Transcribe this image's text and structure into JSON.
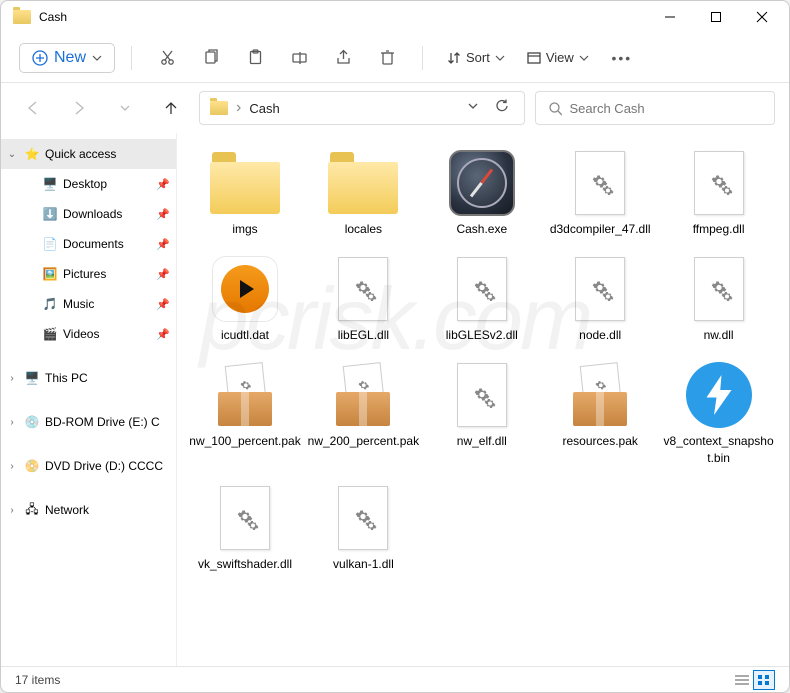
{
  "window": {
    "title": "Cash"
  },
  "toolbar": {
    "new_label": "New",
    "sort_label": "Sort",
    "view_label": "View"
  },
  "address": {
    "path_sep": "›",
    "path_name": "Cash",
    "search_placeholder": "Search Cash"
  },
  "sidebar": {
    "quick_access": "Quick access",
    "quick_items": [
      {
        "label": "Desktop",
        "icon": "desktop"
      },
      {
        "label": "Downloads",
        "icon": "downloads"
      },
      {
        "label": "Documents",
        "icon": "documents"
      },
      {
        "label": "Pictures",
        "icon": "pictures"
      },
      {
        "label": "Music",
        "icon": "music"
      },
      {
        "label": "Videos",
        "icon": "videos"
      }
    ],
    "this_pc": "This PC",
    "bd_drive": "BD-ROM Drive (E:) C",
    "dvd_drive": "DVD Drive (D:) CCCC",
    "network": "Network"
  },
  "files": [
    {
      "name": "imgs",
      "kind": "folder"
    },
    {
      "name": "locales",
      "kind": "folder"
    },
    {
      "name": "Cash.exe",
      "kind": "compass"
    },
    {
      "name": "d3dcompiler_47.dll",
      "kind": "dll"
    },
    {
      "name": "ffmpeg.dll",
      "kind": "dll"
    },
    {
      "name": "icudtl.dat",
      "kind": "play"
    },
    {
      "name": "libEGL.dll",
      "kind": "dll"
    },
    {
      "name": "libGLESv2.dll",
      "kind": "dll"
    },
    {
      "name": "node.dll",
      "kind": "dll"
    },
    {
      "name": "nw.dll",
      "kind": "dll"
    },
    {
      "name": "nw_100_percent.pak",
      "kind": "pak"
    },
    {
      "name": "nw_200_percent.pak",
      "kind": "pak"
    },
    {
      "name": "nw_elf.dll",
      "kind": "dll"
    },
    {
      "name": "resources.pak",
      "kind": "pak"
    },
    {
      "name": "v8_context_snapshot.bin",
      "kind": "lightning"
    },
    {
      "name": "vk_swiftshader.dll",
      "kind": "dll"
    },
    {
      "name": "vulkan-1.dll",
      "kind": "dll"
    }
  ],
  "status": {
    "item_count": "17 items"
  },
  "colors": {
    "accent": "#0078d4"
  }
}
